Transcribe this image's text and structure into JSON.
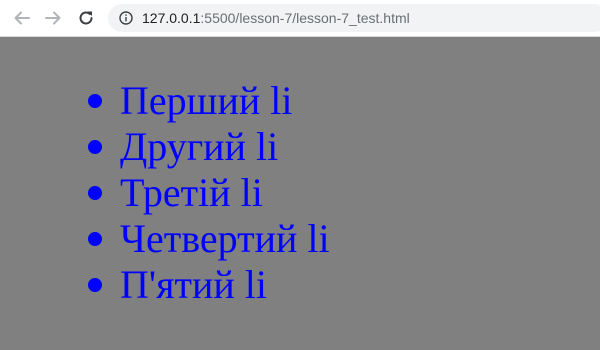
{
  "browser": {
    "url_host": "127.0.0.1",
    "url_path": ":5500/lesson-7/lesson-7_test.html",
    "icons": {
      "back": "arrow-left-icon",
      "forward": "arrow-right-icon",
      "reload": "reload-icon",
      "site_info": "info-icon"
    }
  },
  "page": {
    "background_color": "#808080",
    "text_color": "#0000ff",
    "list_items": [
      "Перший li",
      "Другий li",
      "Третій li",
      "Четвертий li",
      "П'ятий li"
    ]
  }
}
